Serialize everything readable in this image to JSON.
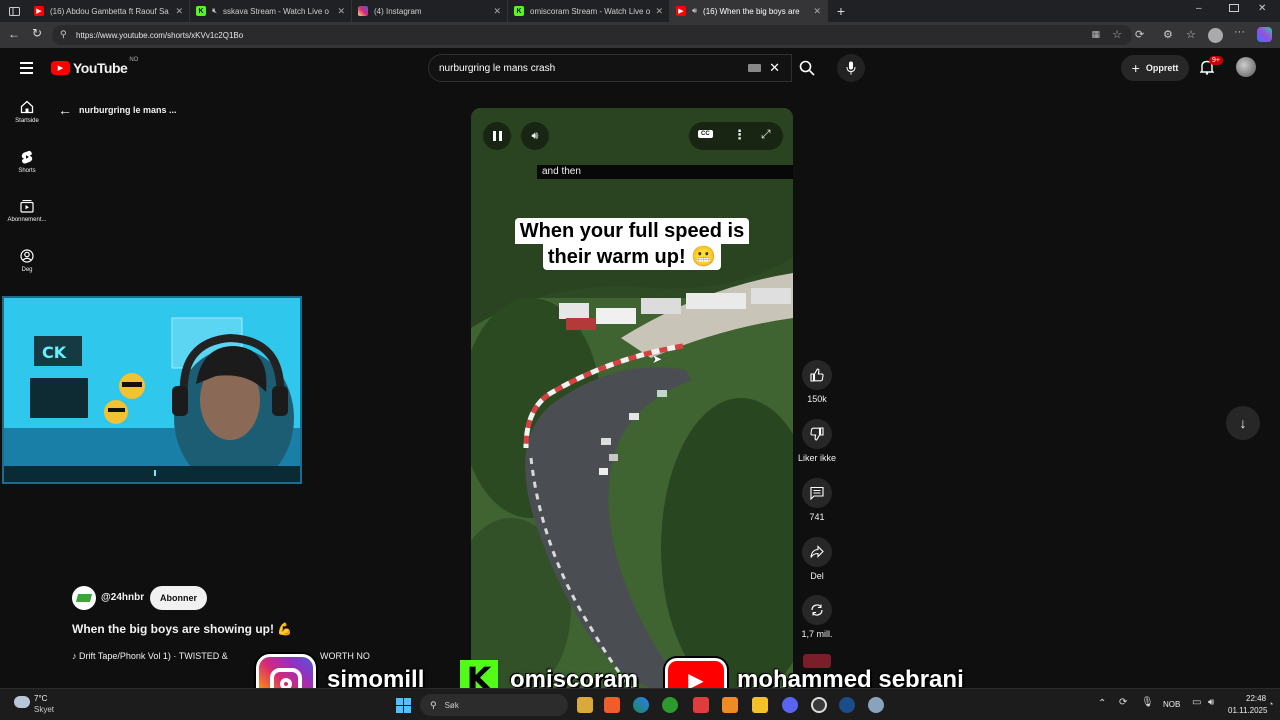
{
  "browser": {
    "tabs": [
      {
        "title": "(16) Abdou Gambetta ft Raouf Sa",
        "icon": "youtube-icon",
        "color": "#ff0000"
      },
      {
        "title": "sskava Stream - Watch Live o",
        "icon": "kick-icon",
        "color": "#53fc18"
      },
      {
        "title": "(4) Instagram",
        "icon": "instagram-icon",
        "color": "#e1306c"
      },
      {
        "title": "omiscoram Stream - Watch Live o",
        "icon": "kick-icon",
        "color": "#53fc18"
      },
      {
        "title": "(16) When the big boys are",
        "icon": "youtube-icon",
        "color": "#ff0000"
      }
    ],
    "url": "https://www.youtube.com/shorts/xKVv1c2Q1Bo"
  },
  "youtube": {
    "logo_text": "YouTube",
    "logo_country": "NO",
    "search_value": "nurburgring le mans crash",
    "create_label": "Opprett",
    "notification_badge": "9+",
    "sidebar": [
      {
        "label": "Startside",
        "icon": "home-icon"
      },
      {
        "label": "Shorts",
        "icon": "shorts-icon"
      },
      {
        "label": "Abonnement...",
        "icon": "subscriptions-icon"
      },
      {
        "label": "Deg",
        "icon": "you-icon"
      }
    ],
    "back_title": "nurburgring le mans ...",
    "video": {
      "caption": "and then",
      "overlay_line1": "When your full speed is",
      "overlay_line2": "their warm up! 😬"
    },
    "actions": [
      {
        "label": "150k",
        "icon": "like-icon"
      },
      {
        "label": "Liker ikke",
        "icon": "dislike-icon"
      },
      {
        "label": "741",
        "icon": "comment-icon"
      },
      {
        "label": "Del",
        "icon": "share-icon"
      },
      {
        "label": "1,7 mill.",
        "icon": "remix-icon"
      }
    ],
    "channel": "@24hnbr",
    "subscribe_label": "Abonner",
    "video_title": "When the big boys are showing up! 💪",
    "music": "♪ Drift Tape/Phonk Vol 1) · TWISTED &",
    "music_tail": "WORTH NO"
  },
  "stream_overlay": {
    "instagram": "simomill",
    "kick": "omiscoram",
    "youtube": "mohammed sebrani"
  },
  "taskbar": {
    "weather_temp": "7°C",
    "weather_desc": "Skyet",
    "search_placeholder": "Søk",
    "lang": "NOB",
    "time": "22:48",
    "date": "01.11.2025"
  }
}
